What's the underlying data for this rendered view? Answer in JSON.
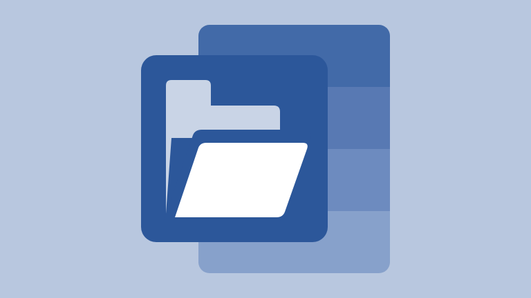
{
  "image": {
    "subject": "file-explorer-app-icon",
    "colors": {
      "background": "#b8c7df",
      "front_tile": "#2c579a",
      "folder_back": "#c9d4e6",
      "folder_front": "#ffffff",
      "back_tile_bands": [
        "#426aa8",
        "#5879b3",
        "#6d8bbf",
        "#87a1cb"
      ]
    }
  }
}
